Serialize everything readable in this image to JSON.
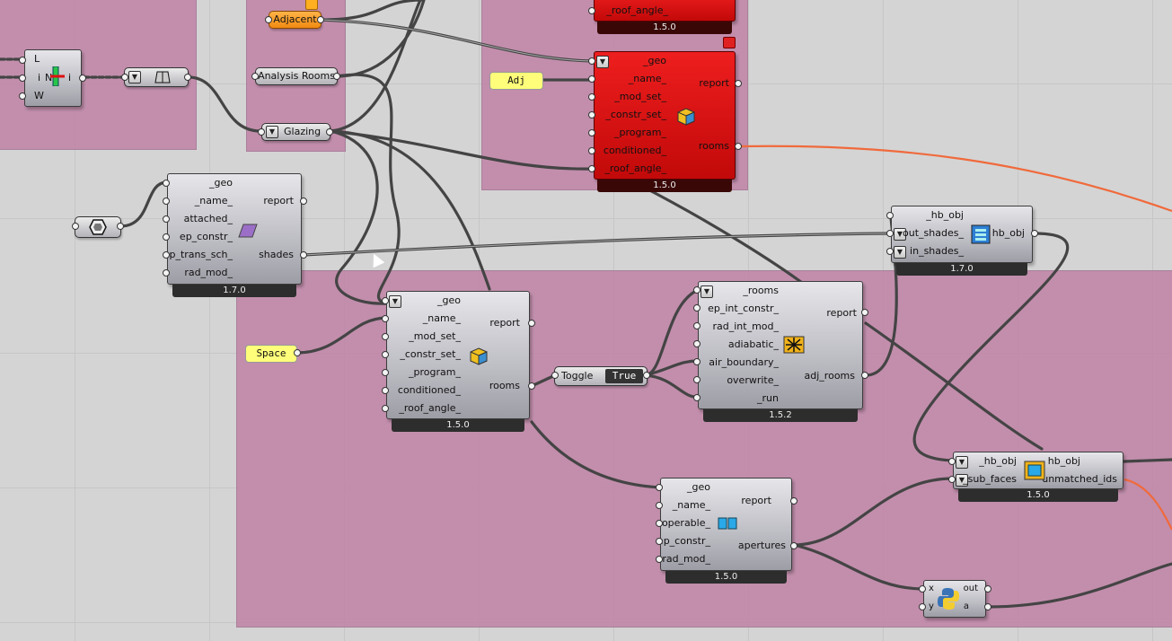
{
  "params": {
    "adjacent": "Adjacent",
    "analysis_rooms": "Analysis Rooms",
    "glazing": "Glazing"
  },
  "panels": {
    "adj": "Adj",
    "space": "Space"
  },
  "vector": {
    "inputs": [
      "L",
      "i",
      "W"
    ],
    "center": "N",
    "output": "i"
  },
  "red_room": {
    "top_input": "_roof_angle_",
    "top_version": "1.5.0",
    "inputs": [
      "_geo",
      "_name_",
      "_mod_set_",
      "_constr_set_",
      "_program_",
      "conditioned_",
      "_roof_angle_"
    ],
    "outputs": [
      "report",
      "rooms"
    ],
    "version": "1.5.0"
  },
  "shade": {
    "inputs": [
      "_geo",
      "_name_",
      "attached_",
      "ep_constr_",
      "ep_trans_sch_",
      "rad_mod_"
    ],
    "outputs": [
      "report",
      "shades"
    ],
    "version": "1.7.0"
  },
  "add_shade": {
    "inputs": [
      "_hb_obj",
      "out_shades_",
      "in_shades_"
    ],
    "outputs": [
      "hb_obj"
    ],
    "version": "1.7.0"
  },
  "room": {
    "inputs": [
      "_geo",
      "_name_",
      "_mod_set_",
      "_constr_set_",
      "_program_",
      "conditioned_",
      "_roof_angle_"
    ],
    "outputs": [
      "report",
      "rooms"
    ],
    "version": "1.5.0"
  },
  "toggle": {
    "label": "Toggle",
    "value": "True"
  },
  "adiabatic": {
    "inputs": [
      "_rooms",
      "ep_int_constr_",
      "rad_int_mod_",
      "adiabatic_",
      "air_boundary_",
      "overwrite_",
      "_run"
    ],
    "outputs": [
      "report",
      "adj_rooms"
    ],
    "version": "1.5.2"
  },
  "aperture": {
    "inputs": [
      "_geo",
      "_name_",
      "operable_",
      "ep_constr_",
      "rad_mod_"
    ],
    "outputs": [
      "report",
      "apertures"
    ],
    "version": "1.5.0"
  },
  "add_subface": {
    "inputs": [
      "_hb_obj",
      "_sub_faces"
    ],
    "outputs": [
      "hb_obj",
      "unmatched_ids"
    ],
    "version": "1.5.0"
  },
  "python": {
    "inputs": [
      "x",
      "y"
    ],
    "outputs": [
      "out",
      "a"
    ]
  },
  "colors": {
    "group": "#be7fa4",
    "canvas": "#d4d4d4",
    "error_component": "#d91414",
    "panel": "#fefe7a",
    "wire_selected": "#f06a3c"
  },
  "icons": [
    "vector-icon",
    "brep-param-icon",
    "hexagon-param-icon",
    "cube-icon",
    "shade-icon",
    "shades-stack-icon",
    "adiabatic-icon",
    "aperture-icon",
    "subface-icon",
    "python-icon"
  ]
}
